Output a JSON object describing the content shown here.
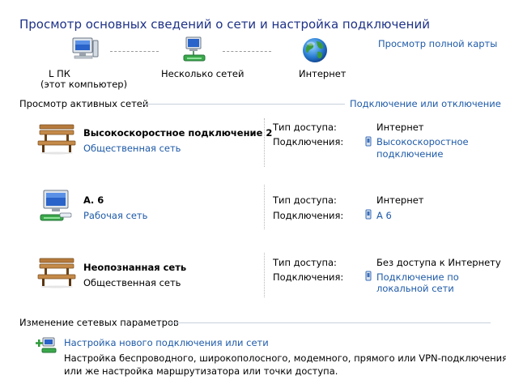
{
  "header": {
    "title": "Просмотр основных сведений о сети и настройка подключений",
    "full_map_link": "Просмотр полной карты"
  },
  "network_map": {
    "computer_label": "L               ПК",
    "computer_sublabel": "(этот компьютер)",
    "networks_label": "Несколько сетей",
    "internet_label": "Интернет"
  },
  "active_networks": {
    "heading": "Просмотр активных сетей",
    "connect_link": "Подключение или отключение",
    "access_type_label": "Тип доступа:",
    "connections_label": "Подключения:",
    "items": [
      {
        "name": "Высокоскоростное подключение  2",
        "category": "Общественная сеть",
        "category_is_link": true,
        "access_type": "Интернет",
        "connection_line1": "Высокоскоростное",
        "connection_line2": "подключение"
      },
      {
        "name": "А.           6",
        "category": "Рабочая сеть",
        "category_is_link": true,
        "access_type": "Интернет",
        "connection_line1": "А          6",
        "connection_line2": ""
      },
      {
        "name": "Неопознанная сеть",
        "category": "Общественная сеть",
        "category_is_link": false,
        "access_type": "Без доступа к Интернету",
        "connection_line1": "Подключение по",
        "connection_line2": "локальной сети"
      }
    ]
  },
  "change_settings": {
    "heading": "Изменение сетевых параметров",
    "setup_link": "Настройка нового подключения или сети",
    "setup_desc_line1": "Настройка беспроводного, широкополосного, модемного, прямого или VPN-подключения",
    "setup_desc_line2": "или же настройка маршрутизатора или точки доступа."
  },
  "colors": {
    "link": "#1e5aa8",
    "title": "#1e3287",
    "divider": "#c8d0dc"
  }
}
